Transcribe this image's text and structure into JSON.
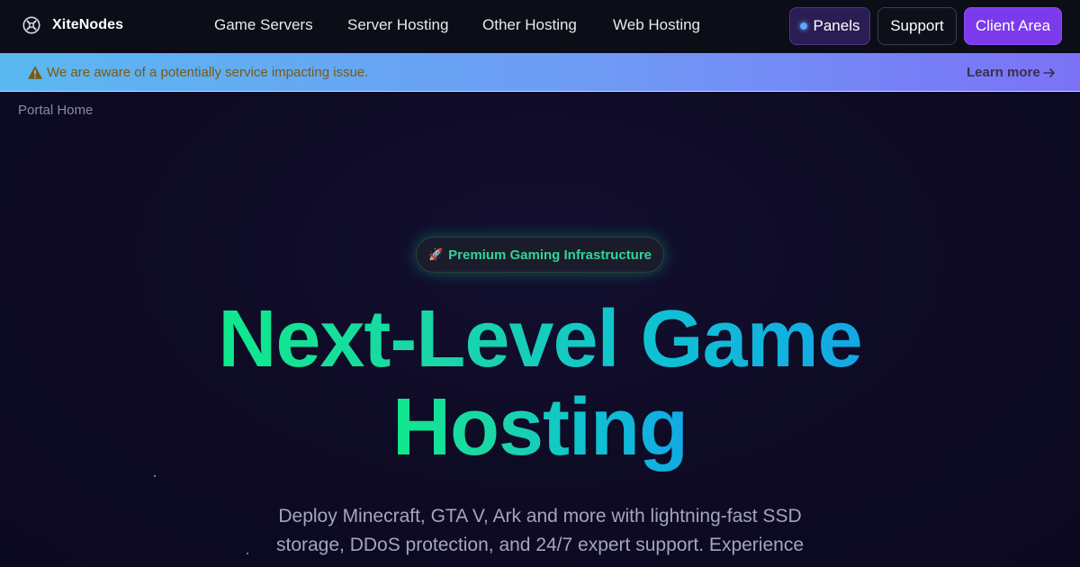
{
  "brand": {
    "name": "XiteNodes",
    "logo_icon": "xitenodes-logo-icon"
  },
  "nav": {
    "items": [
      {
        "label": "Game Servers"
      },
      {
        "label": "Server Hosting"
      },
      {
        "label": "Other Hosting"
      },
      {
        "label": "Web Hosting"
      }
    ],
    "panels_label": "Panels",
    "support_label": "Support",
    "client_area_label": "Client Area"
  },
  "alert": {
    "icon": "warning-icon",
    "message": "We are aware of a potentially service impacting issue.",
    "link_label": "Learn more",
    "link_icon": "arrow-right-icon"
  },
  "breadcrumb": {
    "label": "Portal Home"
  },
  "hero": {
    "badge_icon": "🚀",
    "badge_label": "Premium Gaming Infrastructure",
    "headline_line1": "Next-Level Game",
    "headline_line2": "Hosting",
    "subtitle_line1": "Deploy Minecraft, GTA V, Ark and more with lightning-fast SSD",
    "subtitle_line2": "storage, DDoS protection, and 24/7 expert support. Experience"
  },
  "colors": {
    "nav_bg": "#0b0d17",
    "page_bg": "#0e0b24",
    "accent_purple": "#7c3aed",
    "accent_green": "#10e88c",
    "accent_cyan": "#12a8e6",
    "alert_text": "#7a5a12"
  }
}
